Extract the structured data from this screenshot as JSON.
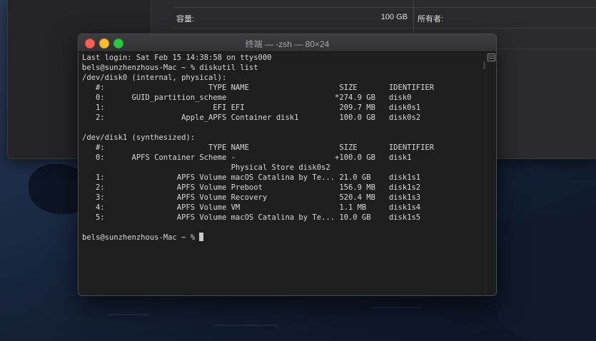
{
  "info_window": {
    "top_left_label": "...",
    "capacity_label": "容量:",
    "capacity_value": "100 GB",
    "owner_label": "所有者:"
  },
  "terminal": {
    "title": "终端 — -zsh — 80×24",
    "lines": [
      "Last login: Sat Feb 15 14:38:58 on ttys000",
      "bels@sunzhenzhous-Mac ~ % diskutil list",
      "/dev/disk0 (internal, physical):",
      "   #:                       TYPE NAME                    SIZE       IDENTIFIER",
      "   0:      GUID_partition_scheme                        *274.9 GB   disk0",
      "   1:                        EFI EFI                     209.7 MB   disk0s1",
      "   2:                 Apple_APFS Container disk1         100.0 GB   disk0s2",
      "",
      "/dev/disk1 (synthesized):",
      "   #:                       TYPE NAME                    SIZE       IDENTIFIER",
      "   0:      APFS Container Scheme -                      +100.0 GB   disk1",
      "                                 Physical Store disk0s2",
      "   1:                APFS Volume macOS Catalina by Te... 21.0 GB    disk1s1",
      "   2:                APFS Volume Preboot                 156.9 MB   disk1s2",
      "   3:                APFS Volume Recovery                520.4 MB   disk1s3",
      "   4:                APFS Volume VM                      1.1 MB     disk1s4",
      "   5:                APFS Volume macOS Catalina by Te... 10.0 GB    disk1s5",
      ""
    ],
    "prompt": "bels@sunzhenzhous-Mac ~ % "
  },
  "icons": {
    "close": "close-icon",
    "minimize": "minimize-icon",
    "zoom": "zoom-icon",
    "scroll_marker": "scroll-marker-icon"
  }
}
